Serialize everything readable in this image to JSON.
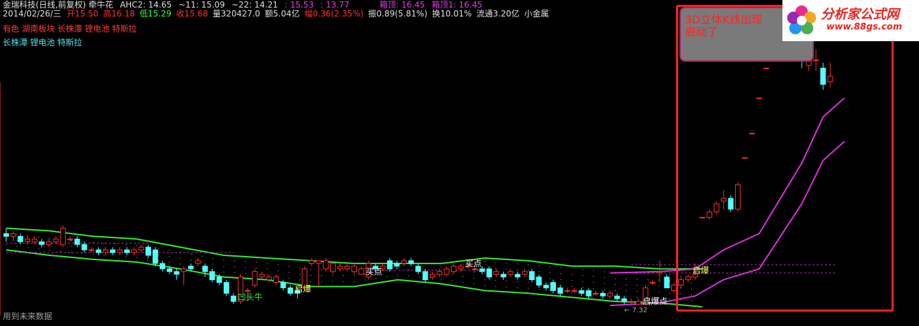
{
  "header": {
    "title": "金瑞科技(日线,前复权) 牵牛花",
    "ahc2": "AHC2: 14.65",
    "t11": "~11: 15.09",
    "t22": "~22: 14.21",
    "v1": ": 15.53",
    "v2": ": 13.77",
    "boxtop": "箱顶: 16.45",
    "boxtop1": "箱顶1: 16.45",
    "date": "2014/02/26/三",
    "open": "开15.50",
    "high": "高16.18",
    "low": "低15.29",
    "close": "收15.68",
    "volume": "量320427.0",
    "amount": "额5.04亿",
    "change": "幅0.36(2.35%)",
    "amplitude": "振0.89(5.81%)",
    "turnover": "换10.01%",
    "float": "流通3.20亿",
    "sector": "小金属"
  },
  "concepts_line1": "有色 湖南板块 长株潭 锂电池 特斯拉",
  "concepts_line2": "长株潭 锂电池 特斯拉",
  "footer": "用到未来数据",
  "annotation": {
    "line1": "3D立体K线出现",
    "line2": "启动了"
  },
  "logo": {
    "name": "分析家公式网",
    "url": "www.88gs.com"
  },
  "colors": {
    "up": "#ff3030",
    "down": "#54ffff",
    "band_green": "#33ee33",
    "band_magenta": "#e030e0",
    "frame": "#ff2020"
  },
  "chart_data": {
    "type": "candlestick",
    "title": "",
    "ylim": [
      7.0,
      17.5
    ],
    "low_marker": "7.32",
    "labels": [
      {
        "text": "凹头牛",
        "color": "#33ee33",
        "x_index": 33,
        "price": 7.6
      },
      {
        "text": "启爆",
        "color": "#ffff66",
        "x_index": 41,
        "price": 7.9
      },
      {
        "text": "买点",
        "color": "#ffffff",
        "x_index": 51,
        "price": 8.55
      },
      {
        "text": "买点",
        "color": "#ffffff",
        "x_index": 65,
        "price": 8.85
      },
      {
        "text": "启爆点",
        "color": "#ffffff",
        "x_index": 90,
        "price": 7.45
      },
      {
        "text": "启爆",
        "color": "#ffff66",
        "x_index": 97,
        "price": 8.6
      }
    ],
    "candles": [
      [
        9.9,
        9.8,
        10.1,
        9.6
      ],
      [
        9.8,
        9.9,
        10.0,
        9.6
      ],
      [
        9.8,
        9.6,
        9.9,
        9.5
      ],
      [
        9.6,
        9.7,
        9.8,
        9.5
      ],
      [
        9.6,
        9.7,
        9.8,
        9.5
      ],
      [
        9.6,
        9.5,
        9.7,
        9.4
      ],
      [
        9.5,
        9.6,
        9.7,
        9.4
      ],
      [
        9.6,
        9.7,
        9.8,
        9.5
      ],
      [
        9.5,
        10.1,
        10.2,
        9.4
      ],
      [
        9.7,
        9.7,
        9.8,
        9.6
      ],
      [
        9.7,
        9.5,
        9.8,
        9.4
      ],
      [
        9.5,
        9.3,
        9.6,
        9.2
      ],
      [
        9.3,
        9.3,
        9.4,
        9.2
      ],
      [
        9.3,
        9.2,
        9.4,
        9.1
      ],
      [
        9.2,
        9.3,
        9.4,
        9.1
      ],
      [
        9.3,
        9.2,
        9.4,
        9.1
      ],
      [
        9.2,
        9.3,
        9.4,
        9.1
      ],
      [
        9.3,
        9.2,
        9.4,
        9.1
      ],
      [
        9.2,
        9.3,
        9.4,
        9.1
      ],
      [
        9.3,
        9.4,
        9.5,
        9.2
      ],
      [
        9.4,
        9.1,
        9.5,
        9.0
      ],
      [
        9.3,
        8.8,
        9.4,
        8.7
      ],
      [
        8.8,
        8.6,
        8.9,
        8.5
      ],
      [
        8.6,
        8.5,
        8.7,
        8.4
      ],
      [
        8.5,
        8.4,
        8.6,
        8.2
      ],
      [
        8.5,
        8.6,
        8.7,
        8.0
      ],
      [
        8.7,
        8.6,
        8.8,
        8.5
      ],
      [
        8.8,
        8.9,
        9.0,
        8.7
      ],
      [
        8.7,
        8.5,
        8.8,
        8.3
      ],
      [
        8.5,
        8.2,
        8.6,
        8.1
      ],
      [
        8.3,
        8.1,
        8.4,
        8.0
      ],
      [
        8.1,
        7.7,
        8.2,
        7.6
      ],
      [
        7.6,
        7.4,
        7.7,
        7.3
      ],
      [
        7.4,
        8.3,
        8.4,
        7.3
      ],
      [
        7.8,
        7.8,
        7.9,
        7.4
      ],
      [
        8.0,
        8.5,
        8.6,
        7.9
      ],
      [
        8.3,
        8.4,
        8.5,
        8.2
      ],
      [
        8.2,
        8.3,
        8.4,
        8.1
      ],
      [
        8.1,
        8.3,
        8.4,
        8.0
      ],
      [
        8.1,
        7.9,
        8.2,
        7.8
      ],
      [
        7.9,
        7.7,
        8.0,
        7.6
      ],
      [
        7.8,
        7.7,
        7.9,
        7.5
      ],
      [
        7.9,
        8.6,
        8.7,
        7.8
      ],
      [
        8.8,
        8.9,
        9.0,
        8.7
      ],
      [
        8.8,
        8.9,
        8.9,
        7.9
      ],
      [
        8.6,
        8.9,
        9.0,
        8.5
      ],
      [
        8.5,
        8.8,
        8.9,
        8.4
      ],
      [
        8.6,
        8.7,
        8.8,
        8.5
      ],
      [
        8.6,
        8.7,
        8.8,
        8.5
      ],
      [
        8.5,
        8.7,
        8.8,
        8.4
      ],
      [
        8.4,
        8.6,
        8.7,
        8.4
      ],
      [
        8.3,
        8.8,
        8.9,
        8.2
      ],
      [
        8.7,
        8.6,
        8.8,
        8.5
      ],
      [
        8.6,
        8.7,
        8.8,
        8.5
      ],
      [
        8.9,
        8.6,
        9.0,
        8.5
      ],
      [
        8.8,
        8.7,
        8.9,
        8.6
      ],
      [
        8.8,
        8.9,
        9.0,
        8.7
      ],
      [
        8.9,
        8.8,
        9.0,
        8.7
      ],
      [
        8.7,
        8.5,
        8.8,
        8.4
      ],
      [
        8.5,
        8.2,
        8.6,
        8.1
      ],
      [
        8.3,
        8.4,
        8.5,
        8.2
      ],
      [
        8.4,
        8.5,
        8.6,
        8.3
      ],
      [
        8.4,
        8.6,
        8.7,
        8.3
      ],
      [
        8.5,
        8.7,
        8.8,
        8.4
      ],
      [
        8.6,
        8.7,
        8.8,
        8.5
      ],
      [
        8.7,
        8.7,
        8.8,
        8.6
      ],
      [
        8.6,
        8.6,
        8.7,
        8.5
      ],
      [
        8.6,
        8.5,
        8.7,
        8.4
      ],
      [
        8.6,
        8.3,
        8.7,
        8.2
      ],
      [
        8.4,
        8.5,
        8.6,
        8.3
      ],
      [
        8.4,
        8.3,
        8.5,
        8.2
      ],
      [
        8.4,
        8.5,
        8.6,
        8.3
      ],
      [
        8.4,
        8.3,
        8.5,
        8.2
      ],
      [
        8.4,
        8.5,
        8.6,
        8.3
      ],
      [
        8.5,
        8.2,
        8.6,
        8.1
      ],
      [
        8.3,
        8.0,
        8.4,
        7.9
      ],
      [
        8.0,
        7.9,
        8.1,
        7.8
      ],
      [
        8.1,
        7.8,
        8.2,
        7.7
      ],
      [
        7.9,
        7.7,
        8.0,
        7.6
      ],
      [
        7.8,
        7.8,
        7.9,
        7.7
      ],
      [
        7.8,
        7.8,
        7.9,
        7.7
      ],
      [
        7.8,
        7.7,
        7.9,
        7.6
      ],
      [
        7.8,
        7.6,
        7.9,
        7.5
      ],
      [
        7.7,
        7.7,
        7.8,
        7.6
      ],
      [
        7.7,
        7.6,
        7.8,
        7.5
      ],
      [
        7.6,
        7.7,
        7.8,
        7.5
      ],
      [
        7.6,
        7.5,
        7.7,
        7.4
      ],
      [
        7.5,
        7.4,
        7.6,
        7.3
      ],
      [
        7.4,
        7.4,
        7.5,
        7.3
      ],
      [
        7.3,
        7.4,
        7.5,
        7.3
      ],
      [
        7.3,
        7.9,
        8.0,
        7.3
      ],
      [
        8.1,
        8.1,
        8.2,
        8.0
      ],
      [
        8.5,
        8.5,
        8.9,
        8.1
      ],
      [
        8.3,
        7.9,
        8.4,
        7.9
      ],
      [
        7.8,
        8.0,
        8.1,
        7.7
      ],
      [
        8.0,
        8.2,
        8.3,
        7.9
      ],
      [
        8.2,
        8.3,
        8.4,
        8.1
      ],
      [
        8.3,
        8.4,
        8.8,
        8.2
      ],
      [
        10.5,
        10.5,
        10.5,
        10.5
      ],
      [
        10.5,
        10.7,
        10.8,
        10.4
      ],
      [
        10.7,
        11.0,
        11.1,
        10.6
      ],
      [
        11.1,
        11.2,
        11.5,
        10.8
      ],
      [
        11.2,
        10.8,
        11.3,
        10.7
      ],
      [
        10.8,
        11.7,
        11.8,
        10.7
      ],
      [
        12.7,
        12.7,
        12.7,
        12.7
      ],
      [
        13.6,
        13.6,
        13.6,
        13.6
      ],
      [
        14.9,
        14.9,
        14.9,
        14.9
      ],
      [
        16.0,
        16.0,
        16.0,
        16.0
      ],
      [
        16.5,
        16.5,
        16.5,
        16.5
      ],
      [
        16.5,
        16.8,
        17.2,
        16.3
      ],
      [
        16.8,
        17.0,
        17.3,
        16.7
      ],
      [
        16.9,
        16.4,
        17.2,
        16.3
      ],
      [
        16.5,
        16.3,
        16.7,
        16.0
      ],
      [
        16.1,
        16.5,
        16.8,
        15.9
      ],
      [
        16.3,
        16.3,
        16.7,
        15.9
      ],
      [
        16.0,
        15.4,
        16.2,
        15.2
      ],
      [
        15.5,
        15.7,
        16.2,
        15.3
      ]
    ],
    "band_green_upper": [
      10.1,
      10.0,
      9.8,
      9.7,
      9.4,
      9.1,
      9.0,
      8.9,
      8.8,
      8.8,
      8.8,
      9.0,
      8.9,
      8.7,
      8.7,
      8.6,
      8.6
    ],
    "band_green_lower": [
      9.3,
      9.1,
      8.95,
      8.85,
      8.6,
      8.3,
      8.2,
      7.95,
      7.95,
      8.2,
      8.05,
      7.8,
      7.7,
      7.55,
      7.4,
      7.35,
      7.2
    ],
    "magenta_upper_x": [
      85,
      92,
      97,
      101,
      106,
      112,
      115,
      118
    ],
    "magenta_upper": [
      8.45,
      8.5,
      8.6,
      9.3,
      9.9,
      12.5,
      14.2,
      14.9
    ],
    "magenta_lower_x": [
      85,
      92,
      97,
      101,
      106,
      112,
      115,
      118
    ],
    "magenta_lower": [
      7.25,
      7.35,
      7.6,
      8.2,
      8.6,
      11.0,
      12.6,
      13.3
    ]
  }
}
